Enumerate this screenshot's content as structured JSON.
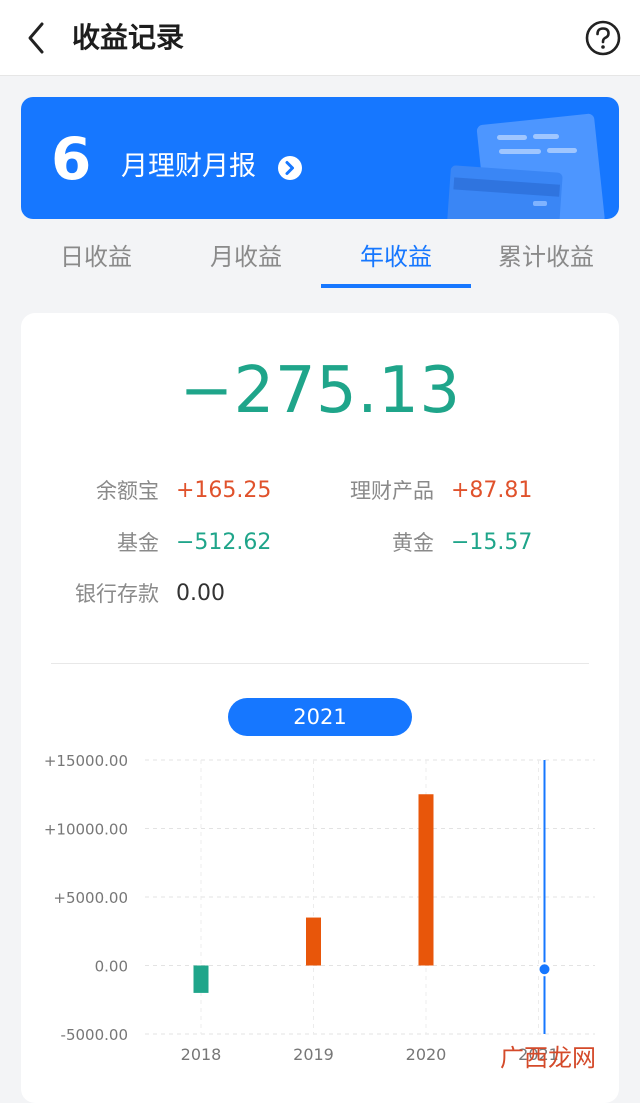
{
  "header": {
    "title": "收益记录",
    "back_icon": "chevron-left-icon",
    "help_icon": "question-circle-icon"
  },
  "banner": {
    "month": "6",
    "text": "月理财月报",
    "arrow_icon": "chevron-right-circle-icon",
    "bg_color": "#1677ff"
  },
  "tabs": [
    {
      "label": "日收益",
      "active": false
    },
    {
      "label": "月收益",
      "active": false
    },
    {
      "label": "年收益",
      "active": true
    },
    {
      "label": "累计收益",
      "active": false
    }
  ],
  "summary": {
    "total": "−275.13",
    "stats": [
      {
        "label": "余额宝",
        "value": "+165.25",
        "sign": "pos"
      },
      {
        "label": "理财产品",
        "value": "+87.81",
        "sign": "pos"
      },
      {
        "label": "基金",
        "value": "−512.62",
        "sign": "neg"
      },
      {
        "label": "黄金",
        "value": "−15.57",
        "sign": "neg"
      },
      {
        "label": "银行存款",
        "value": "0.00",
        "sign": "zero"
      }
    ]
  },
  "year_selector": "2021",
  "chart_data": {
    "type": "bar",
    "categories": [
      "2018",
      "2019",
      "2020",
      "2021"
    ],
    "values": [
      -2000,
      3500,
      12500,
      -275.13
    ],
    "ylim": [
      -5000,
      15000
    ],
    "yticks": [
      "+15000.00",
      "+10000.00",
      "+5000.00",
      "0.00",
      "-5000.00"
    ],
    "ytick_values": [
      15000,
      10000,
      5000,
      0,
      -5000
    ],
    "positive_color": "#e8560a",
    "negative_color": "#1fa58a",
    "selected_index": 3,
    "selected_color": "#1677ff",
    "grid": true,
    "xlabel": "",
    "ylabel": ""
  },
  "watermark": "广西龙网"
}
